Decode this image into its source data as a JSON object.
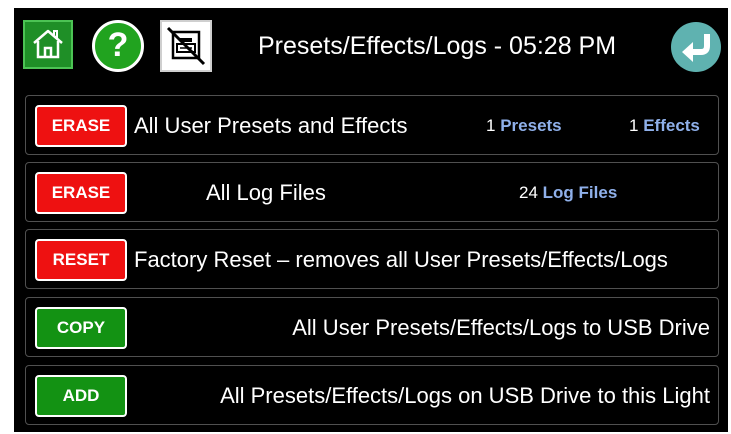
{
  "header": {
    "title": "Presets/Effects/Logs - 05:28 PM",
    "icons": {
      "home": "home-icon",
      "help": "help-icon",
      "network": "network-disconnected-icon",
      "back": "back-icon"
    },
    "help_glyph": "?"
  },
  "rows": [
    {
      "button": "ERASE",
      "button_color": "#ee1111",
      "text": "All User Presets and Effects",
      "counts": [
        {
          "value": "1",
          "label": "Presets"
        },
        {
          "value": "1",
          "label": "Effects"
        }
      ]
    },
    {
      "button": "ERASE",
      "button_color": "#ee1111",
      "text": "All Log Files",
      "counts": [
        {
          "value": "24",
          "label": "Log Files"
        }
      ]
    },
    {
      "button": "RESET",
      "button_color": "#ee1111",
      "text": "Factory Reset – removes all User Presets/Effects/Logs"
    },
    {
      "button": "COPY",
      "button_color": "#139213",
      "text": "All User Presets/Effects/Logs to USB Drive"
    },
    {
      "button": "ADD",
      "button_color": "#139213",
      "text": "All Presets/Effects/Logs on USB Drive to this Light"
    }
  ],
  "colors": {
    "count_label": "#8fb0ea",
    "background": "#000000"
  }
}
